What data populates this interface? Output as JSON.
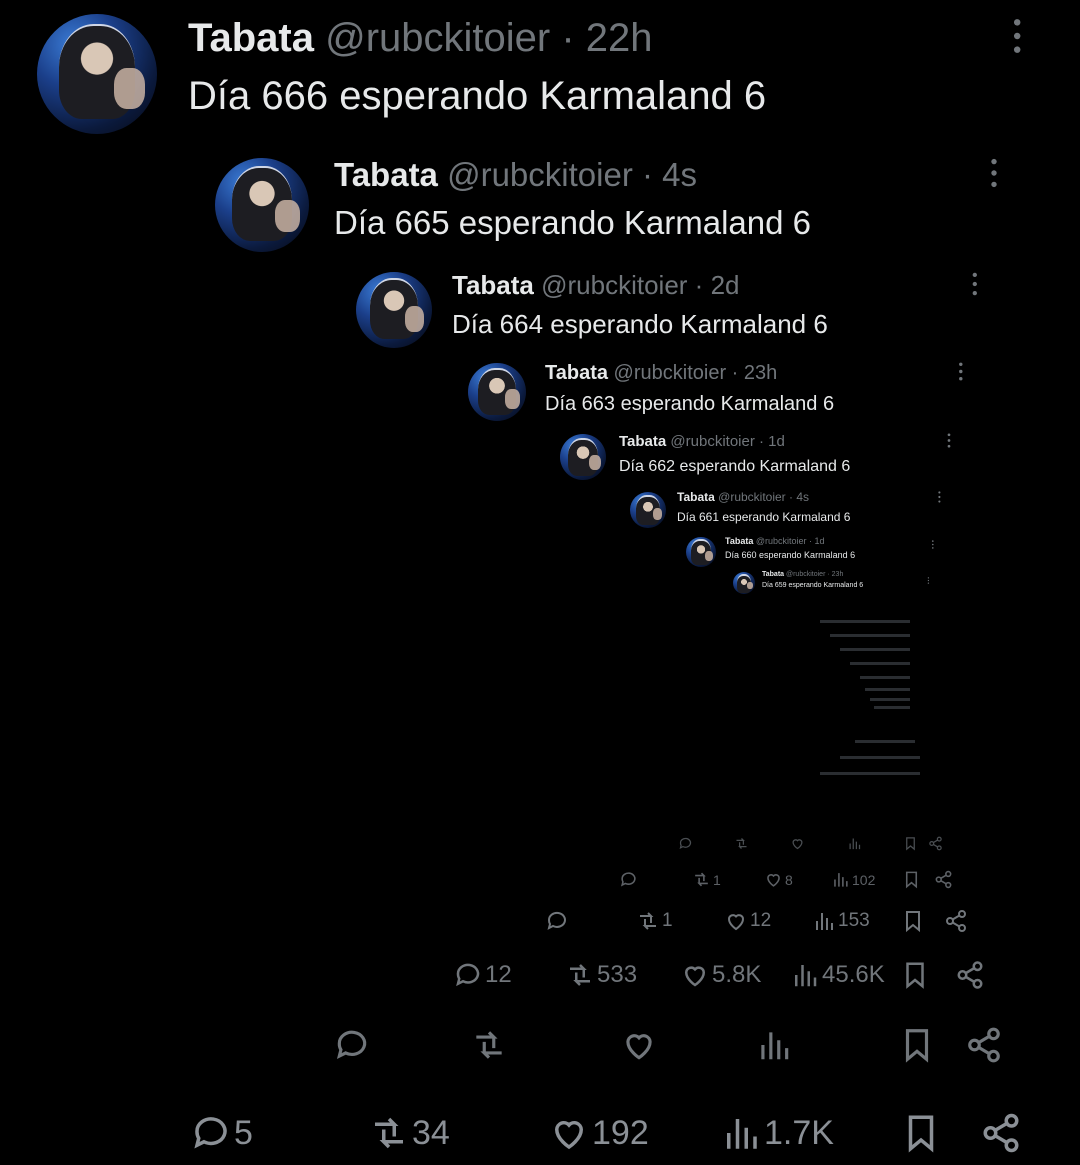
{
  "tweets": [
    {
      "name": "Tabata",
      "handle": "@rubckitoier",
      "sep": "·",
      "time": "22h",
      "text": "Día 666 esperando Karmaland 6"
    },
    {
      "name": "Tabata",
      "handle": "@rubckitoier",
      "sep": "·",
      "time": "4s",
      "text": "Día 665 esperando Karmaland 6"
    },
    {
      "name": "Tabata",
      "handle": "@rubckitoier",
      "sep": "·",
      "time": "2d",
      "text": "Día 664 esperando Karmaland 6"
    },
    {
      "name": "Tabata",
      "handle": "@rubckitoier",
      "sep": "·",
      "time": "23h",
      "text": "Día 663 esperando Karmaland 6"
    },
    {
      "name": "Tabata",
      "handle": "@rubckitoier",
      "sep": "·",
      "time": "1d",
      "text": "Día 662 esperando Karmaland 6"
    },
    {
      "name": "Tabata",
      "handle": "@rubckitoier",
      "sep": "·",
      "time": "4s",
      "text": "Día 661 esperando Karmaland 6"
    },
    {
      "name": "Tabata",
      "handle": "@rubckitoier",
      "sep": "·",
      "time": "1d",
      "text": "Día 660 esperando Karmaland 6"
    },
    {
      "name": "Tabata",
      "handle": "@rubckitoier",
      "sep": "·",
      "time": "23h",
      "text": "Día 659 esperando Karmaland 6"
    }
  ],
  "action_rows": [
    {
      "replies": "5",
      "reposts": "34",
      "likes": "192",
      "views": "1.7K"
    },
    {
      "replies": "",
      "reposts": "",
      "likes": "",
      "views": ""
    },
    {
      "replies": "12",
      "reposts": "533",
      "likes": "5.8K",
      "views": "45.6K"
    },
    {
      "replies": "",
      "reposts": "1",
      "likes": "12",
      "views": "153"
    },
    {
      "replies": "",
      "reposts": "1",
      "likes": "8",
      "views": "102"
    },
    {
      "replies": "",
      "reposts": "",
      "likes": "",
      "views": ""
    }
  ],
  "icons": {
    "reply": "reply-icon",
    "repost": "repost-icon",
    "like": "heart-icon",
    "views": "views-icon",
    "bookmark": "bookmark-icon",
    "share": "share-icon",
    "more": "more-vertical-icon"
  },
  "colors": {
    "background": "#000000",
    "text": "#e7e9ea",
    "muted": "#71767b"
  }
}
